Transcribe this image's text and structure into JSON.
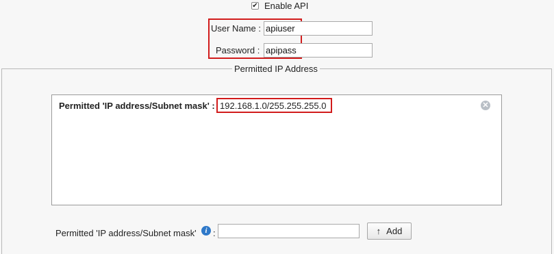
{
  "api": {
    "enable_label": "Enable API",
    "enabled": true,
    "username_label": "User Name :",
    "username_value": "apiuser",
    "password_label": "Password :",
    "password_value": "apipass"
  },
  "permitted_section": {
    "legend": "Permitted IP Address",
    "entry_label": "Permitted 'IP address/Subnet mask' :",
    "entry_value": "192.168.1.0/255.255.255.0",
    "remove_icon": "remove-circle-x-icon",
    "add_label": "Permitted 'IP address/Subnet mask'",
    "add_colon": ":",
    "info_icon": "info-icon",
    "add_input_value": "",
    "add_button_arrow": "↑",
    "add_button_label": "Add"
  },
  "colors": {
    "highlight": "#d11b1b",
    "info": "#2f79c9"
  }
}
